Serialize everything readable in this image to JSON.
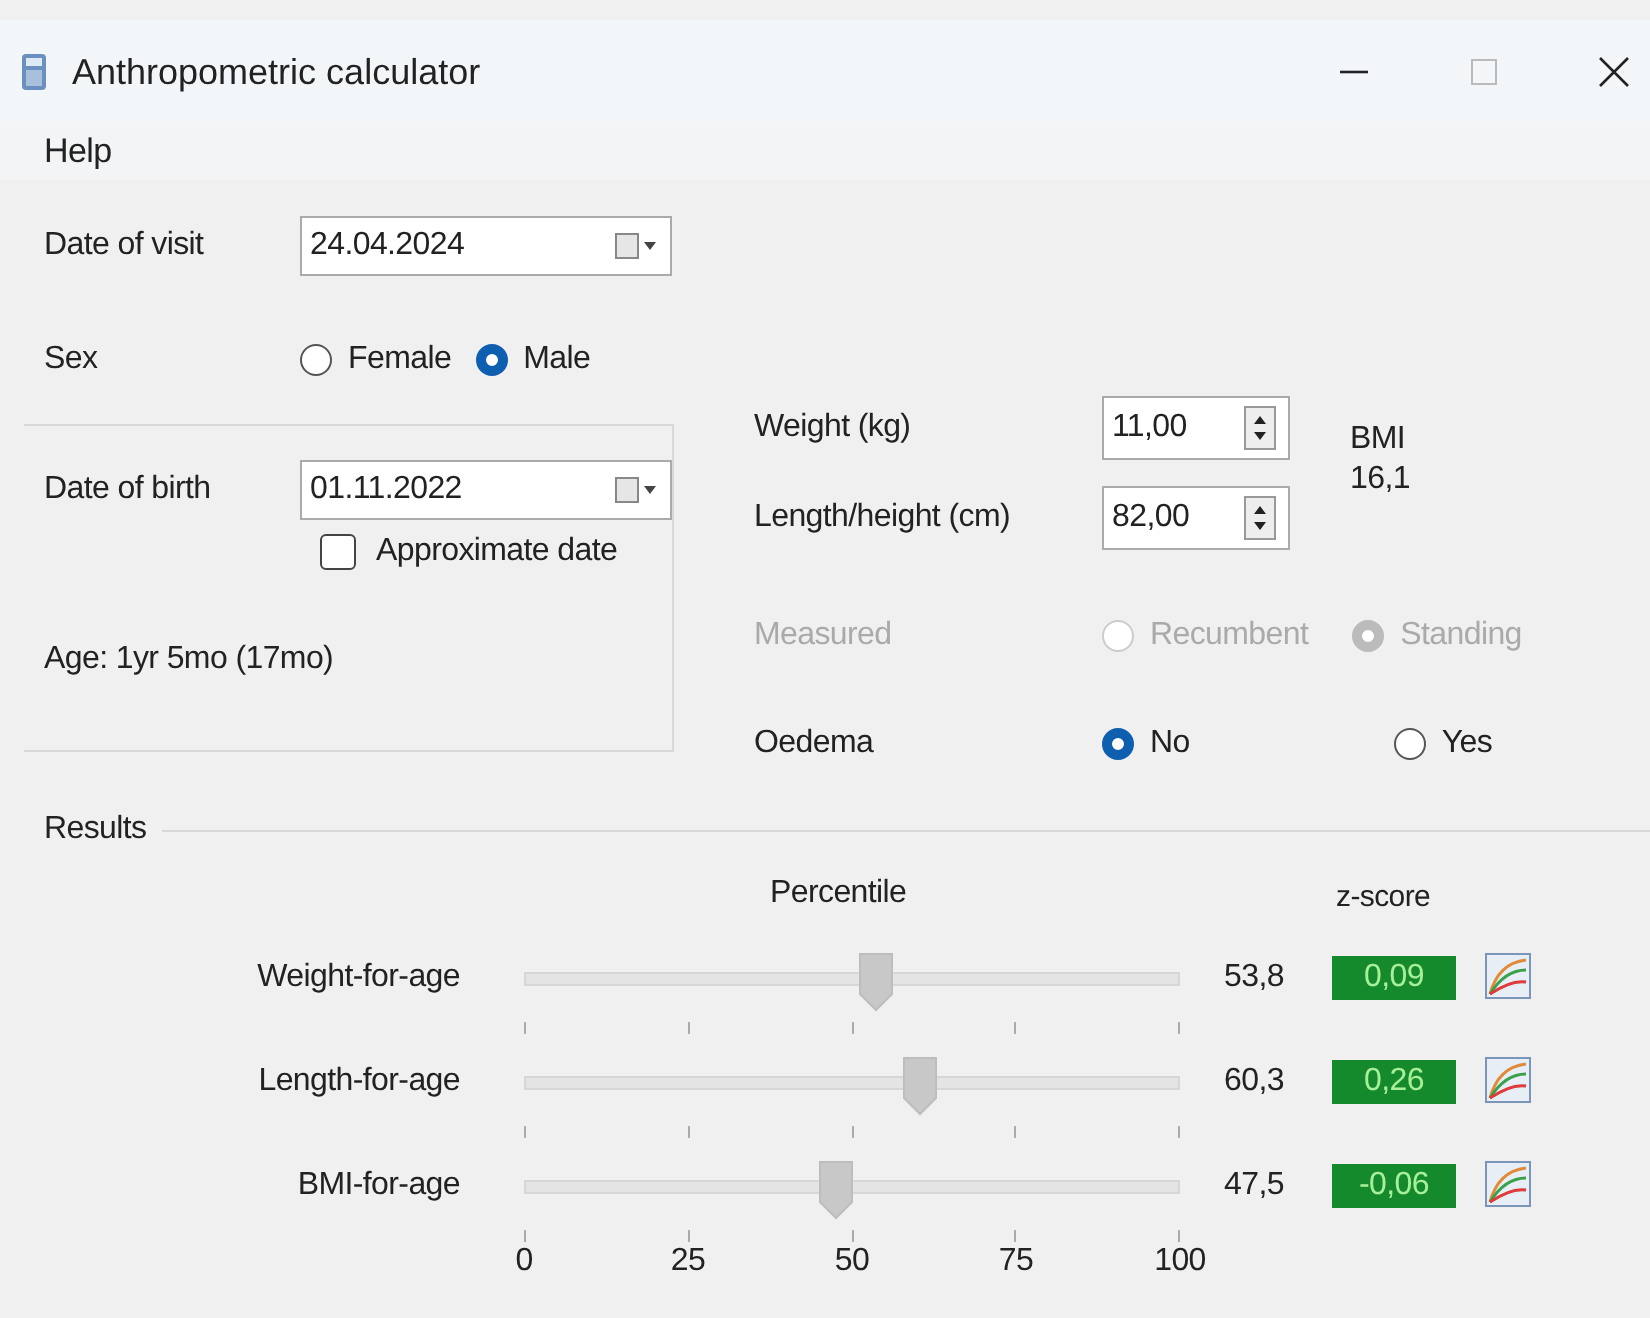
{
  "window": {
    "title": "Anthropometric calculator"
  },
  "menu": [
    {
      "label": "Help"
    }
  ],
  "date_of_visit": {
    "label": "Date of visit",
    "value": "24.04.2024"
  },
  "sex": {
    "label": "Sex",
    "options": [
      {
        "label": "Female",
        "selected": false
      },
      {
        "label": "Male",
        "selected": true
      }
    ]
  },
  "birth": {
    "label": "Date of birth",
    "value": "01.11.2022",
    "approximate": {
      "label": "Approximate date",
      "checked": false
    },
    "age": "Age: 1yr 5mo (17mo)"
  },
  "weight": {
    "label": "Weight (kg)",
    "value": "11,00"
  },
  "height": {
    "label": "Length/height (cm)",
    "value": "82,00"
  },
  "bmi": {
    "label": "BMI",
    "value": "16,1"
  },
  "measured": {
    "label": "Measured",
    "disabled": true,
    "options": [
      {
        "label": "Recumbent",
        "selected": false
      },
      {
        "label": "Standing",
        "selected": true
      }
    ]
  },
  "oedema": {
    "label": "Oedema",
    "options": [
      {
        "label": "No",
        "selected": true
      },
      {
        "label": "Yes",
        "selected": false
      }
    ]
  },
  "results": {
    "title": "Results",
    "percentile_header": "Percentile",
    "zscore_header": "z-score",
    "rows": [
      {
        "label": "Weight-for-age",
        "level": 0.538,
        "percentile": "53,8",
        "zscore": "0,09"
      },
      {
        "label": "Length-for-age",
        "level": 0.603,
        "percentile": "60,3",
        "zscore": "0,26"
      },
      {
        "label": "BMI-for-age",
        "level": 0.475,
        "percentile": "47,5",
        "zscore": "-0,06"
      }
    ],
    "scale": [
      "0",
      "25",
      "50",
      "75",
      "100"
    ]
  }
}
